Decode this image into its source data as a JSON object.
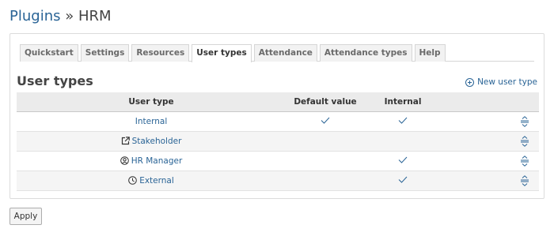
{
  "breadcrumb": {
    "parent": "Plugins",
    "separator": " » ",
    "current": "HRM"
  },
  "tabs": [
    {
      "label": "Quickstart",
      "active": false
    },
    {
      "label": "Settings",
      "active": false
    },
    {
      "label": "Resources",
      "active": false
    },
    {
      "label": "User types",
      "active": true
    },
    {
      "label": "Attendance",
      "active": false
    },
    {
      "label": "Attendance types",
      "active": false
    },
    {
      "label": "Help",
      "active": false
    }
  ],
  "section": {
    "title": "User types",
    "new_label": "New user type",
    "new_icon": "plus-circle-icon"
  },
  "table": {
    "headers": {
      "name": "User type",
      "default": "Default value",
      "internal": "Internal"
    },
    "rows": [
      {
        "name": "Internal",
        "icon": "",
        "default": true,
        "internal": true
      },
      {
        "name": "Stakeholder",
        "icon": "external-link-icon",
        "default": false,
        "internal": false
      },
      {
        "name": "HR Manager",
        "icon": "user-circle-icon",
        "default": false,
        "internal": true
      },
      {
        "name": "External",
        "icon": "clock-icon",
        "default": false,
        "internal": true
      }
    ]
  },
  "apply_label": "Apply",
  "colors": {
    "link": "#2a6496",
    "header_bg": "#ebebeb"
  }
}
